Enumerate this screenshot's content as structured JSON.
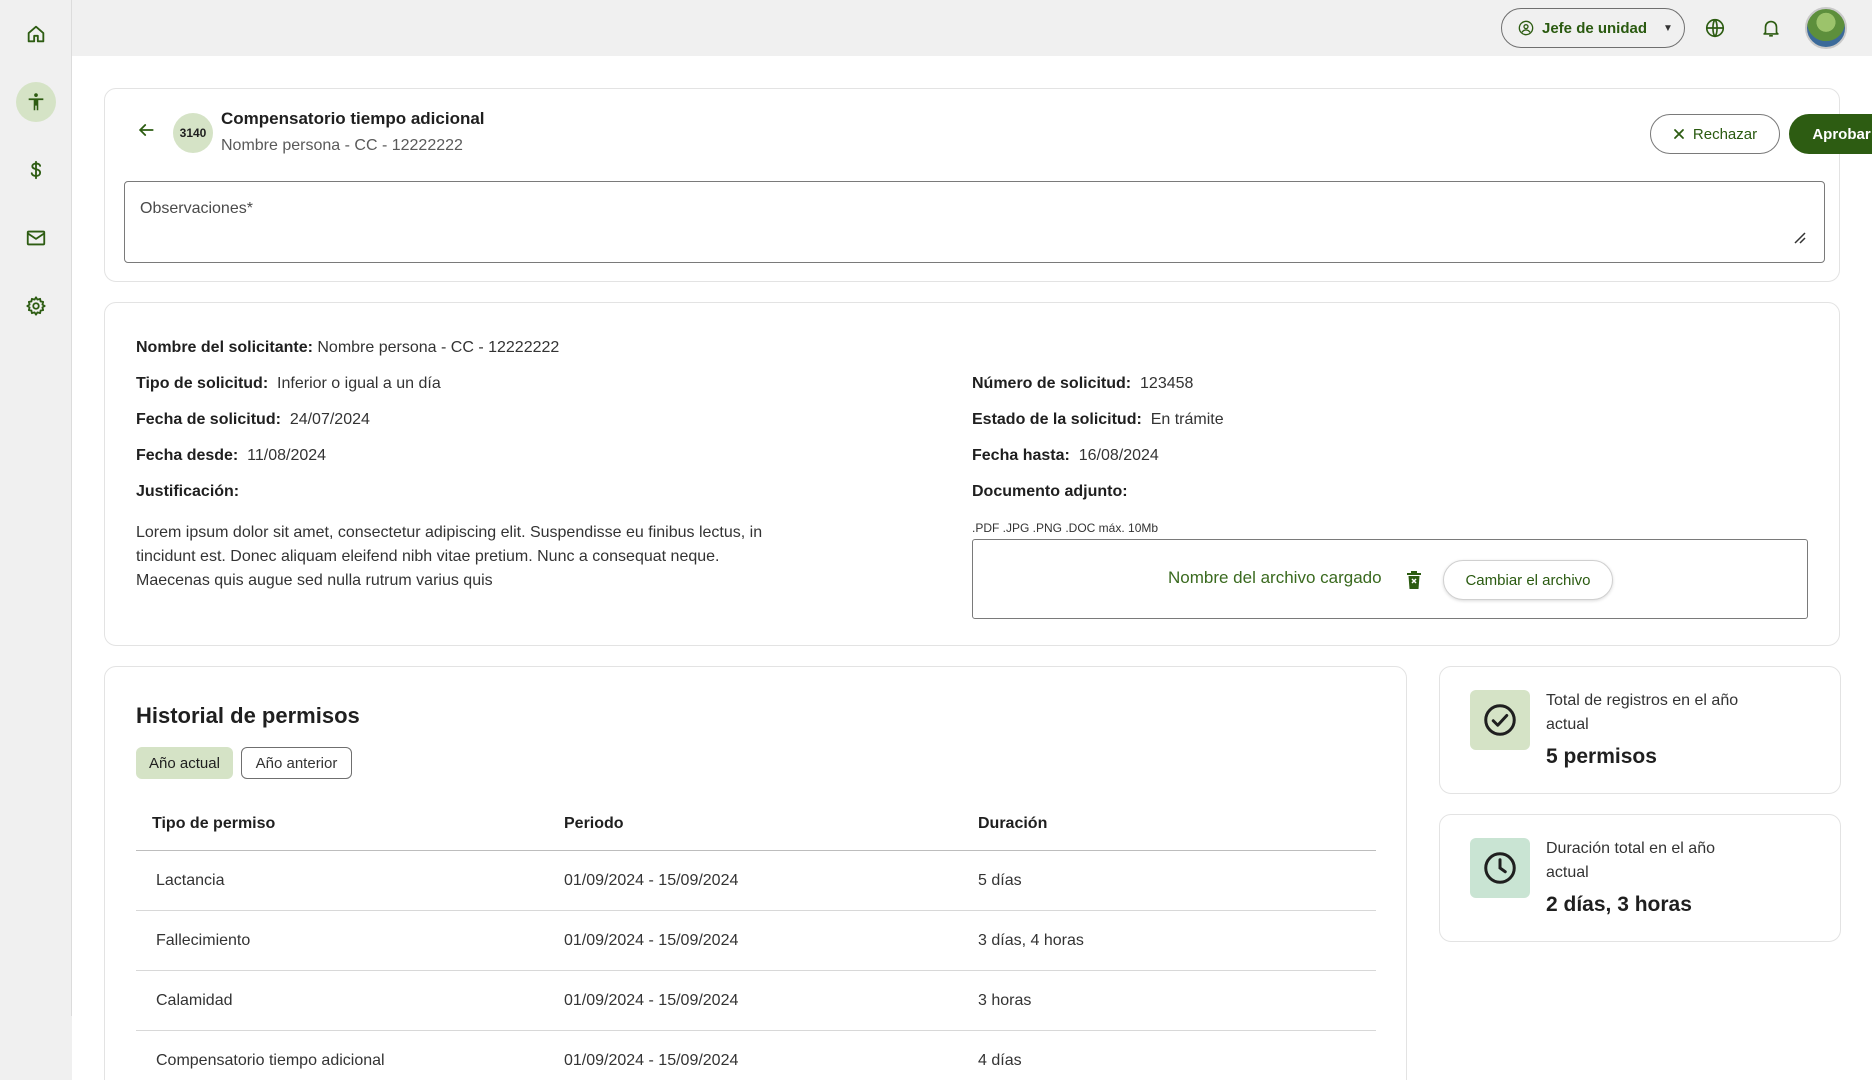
{
  "topbar": {
    "role_label": "Jefe de unidad"
  },
  "sidebar": {
    "items": [
      {
        "icon": "home-icon"
      },
      {
        "icon": "accessibility-icon",
        "active": true
      },
      {
        "icon": "dollar-icon"
      },
      {
        "icon": "mail-icon"
      },
      {
        "icon": "gear-icon"
      }
    ]
  },
  "request": {
    "id": "3140",
    "title": "Compensatorio tiempo adicional",
    "subtitle": "Nombre persona - CC - 12222222",
    "reject_label": "Rechazar",
    "approve_label": "Aprobar",
    "observations_label": "Observaciones*"
  },
  "details": {
    "applicant_label": "Nombre del solicitante:",
    "applicant_value": "Nombre persona - CC - 12222222",
    "type_label": "Tipo de solicitud:",
    "type_value": "Inferior o igual a un día",
    "number_label": "Número de solicitud:",
    "number_value": "123458",
    "date_label": "Fecha de solicitud:",
    "date_value": "24/07/2024",
    "status_label": "Estado de la solicitud:",
    "status_value": "En trámite",
    "from_label": "Fecha desde:",
    "from_value": "11/08/2024",
    "to_label": "Fecha hasta:",
    "to_value": "16/08/2024",
    "justification_label": "Justificación:",
    "justification_text": "Lorem ipsum dolor sit amet, consectetur adipiscing elit. Suspendisse eu finibus lectus, in tincidunt est. Donec aliquam eleifend nibh vitae pretium. Nunc a consequat neque. Maecenas quis augue sed nulla rutrum varius quis",
    "attachment_label": "Documento adjunto:",
    "attachment_formats": ".PDF .JPG .PNG .DOC máx. 10Mb",
    "file_name": "Nombre del archivo cargado",
    "change_file_label": "Cambiar el archivo"
  },
  "history": {
    "title": "Historial de permisos",
    "filters": [
      "Año actual",
      "Año anterior"
    ],
    "selected_filter": "Año actual",
    "columns": [
      "Tipo de permiso",
      "Periodo",
      "Duración"
    ],
    "rows": [
      [
        "Lactancia",
        "01/09/2024 - 15/09/2024",
        "5 días"
      ],
      [
        "Fallecimiento",
        "01/09/2024 - 15/09/2024",
        "3 días, 4 horas"
      ],
      [
        "Calamidad",
        "01/09/2024 - 15/09/2024",
        "3 horas"
      ],
      [
        "Compensatorio tiempo adicional",
        "01/09/2024 - 15/09/2024",
        "4 días"
      ]
    ]
  },
  "stats": {
    "total_label": "Total de registros en el año actual",
    "total_value": "5 permisos",
    "duration_label": "Duración total en el año actual",
    "duration_value": "2 días, 3 horas"
  },
  "colors": {
    "brand_green": "#2d5c12",
    "accent_green_light": "#d5e3c6",
    "mint": "#c9e4d3"
  }
}
